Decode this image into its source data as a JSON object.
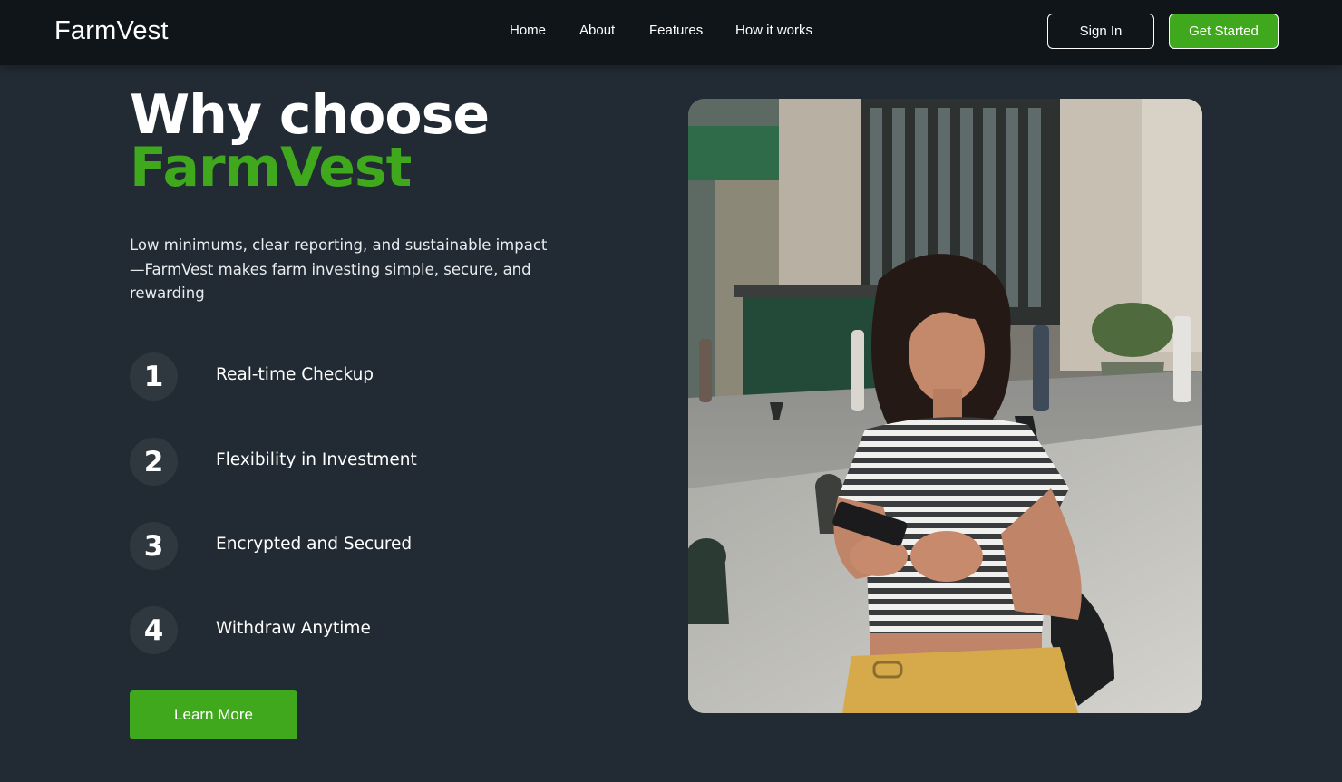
{
  "brand": {
    "name": "FarmVest",
    "accent_color": "#3fa81c"
  },
  "nav": {
    "links": [
      "Home",
      "About",
      "Features",
      "How it works"
    ],
    "signin_label": "Sign In",
    "cta_label": "Get Started"
  },
  "hero": {
    "title_line1": "Why choose",
    "title_line2": "FarmVest",
    "description": "Low minimums, clear reporting, and sustainable impact—FarmVest makes farm investing simple, secure, and rewarding",
    "features": [
      {
        "number": "1",
        "label": "Real-time Checkup"
      },
      {
        "number": "2",
        "label": "Flexibility in Investment"
      },
      {
        "number": "3",
        "label": "Encrypted and Secured"
      },
      {
        "number": "4",
        "label": "Withdraw Anytime"
      }
    ],
    "button_label": "Learn More"
  }
}
